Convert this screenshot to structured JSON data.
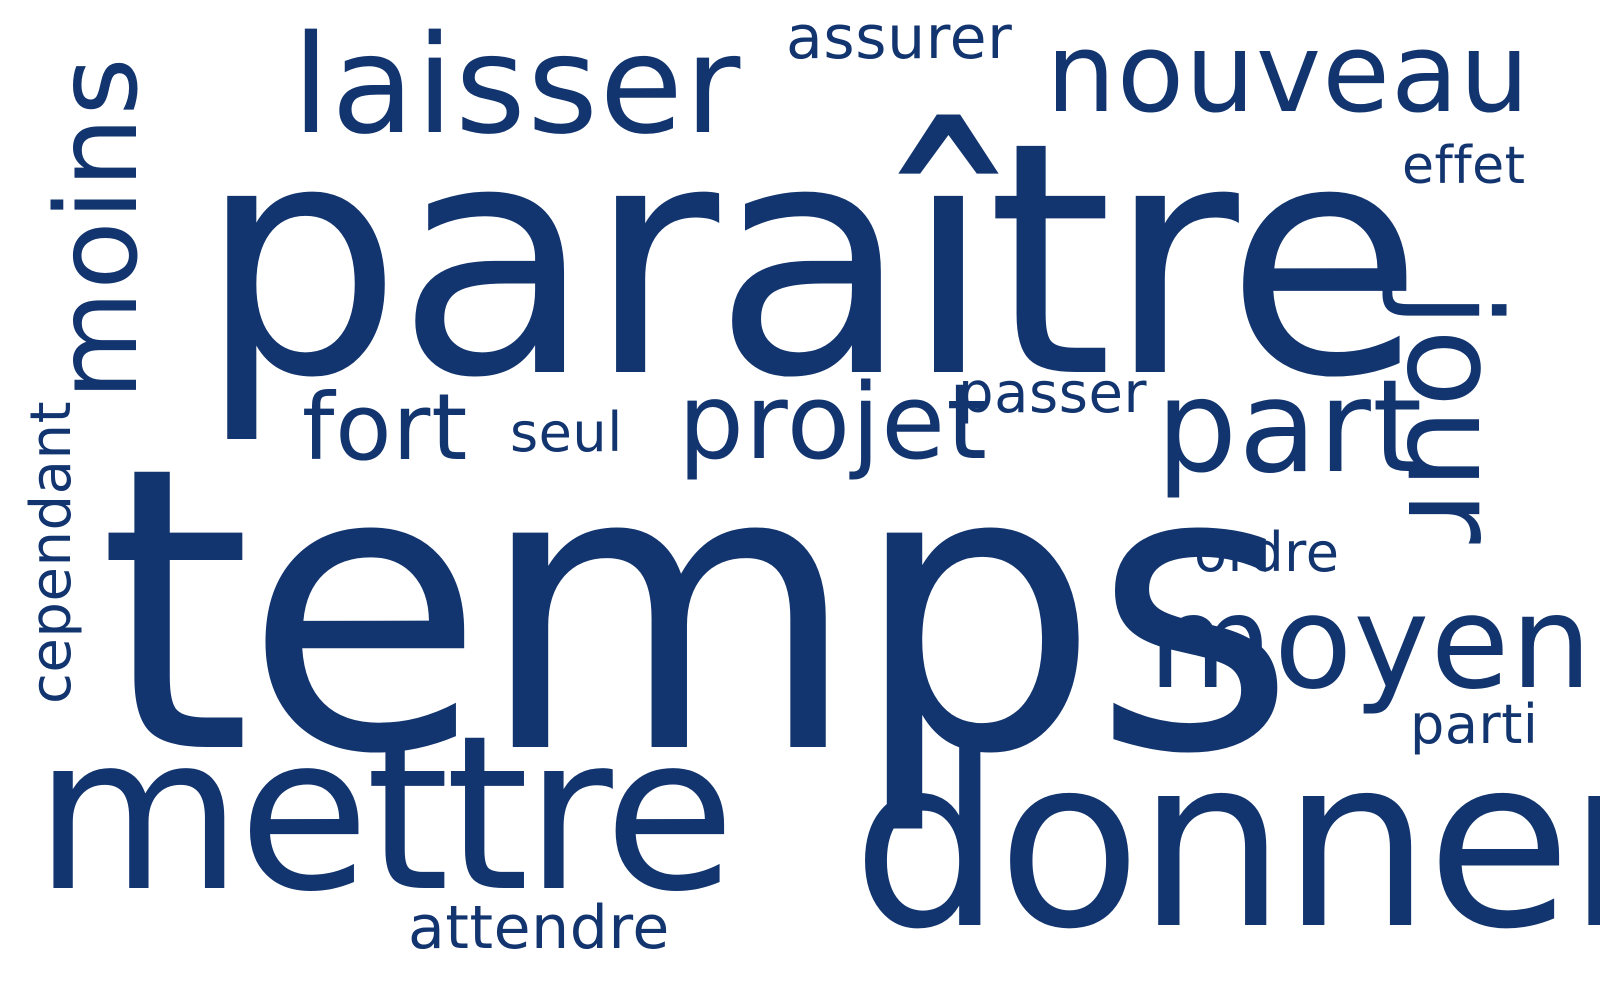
{
  "word_cloud": {
    "color": "#13356f",
    "background": "#ffffff",
    "words": {
      "laisser": "laisser",
      "assurer": "assurer",
      "nouveau": "nouveau",
      "effet": "effet",
      "paraitre": "paraître",
      "moins": "moins",
      "fort": "fort",
      "seul": "seul",
      "projet": "projet",
      "passer": "passer",
      "part": "part",
      "jour": "jour",
      "cependant": "cependant",
      "temps": "temps",
      "ordre": "ordre",
      "moyen": "moyen",
      "parti": "parti",
      "mettre": "mettre",
      "donner": "donner",
      "attendre": "attendre"
    }
  }
}
